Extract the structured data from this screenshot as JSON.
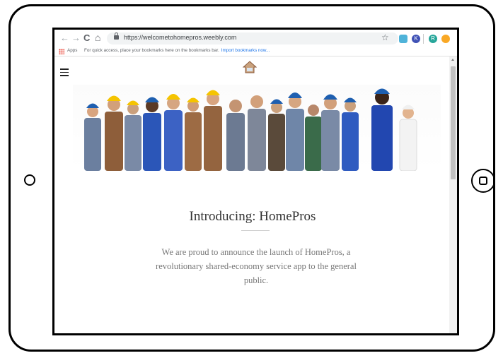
{
  "browser": {
    "url": "https://welcometohomepros.weebly.com",
    "nav_back": "←",
    "nav_forward": "→",
    "nav_reload": "C",
    "nav_home": "⌂",
    "star_icon": "☆",
    "extensions": [
      {
        "name": "extension-1",
        "color": "#4fb3d9"
      },
      {
        "name": "extension-2",
        "color": "#1e88e5",
        "letter": "K"
      },
      {
        "name": "extension-3",
        "color": "#26a69a",
        "letter": "R"
      },
      {
        "name": "extension-4",
        "color": "#f9a825"
      }
    ]
  },
  "bookmarks_bar": {
    "apps_label": "Apps",
    "message": "For quick access, place your bookmarks here on the bookmarks bar.",
    "import_link": "Import bookmarks now..."
  },
  "page": {
    "heading": "Introducing: HomePros",
    "body": "We are proud to announce the launch of HomePros, a revolutionary shared-economy service app to the general public.",
    "accent_color": "#333333"
  }
}
